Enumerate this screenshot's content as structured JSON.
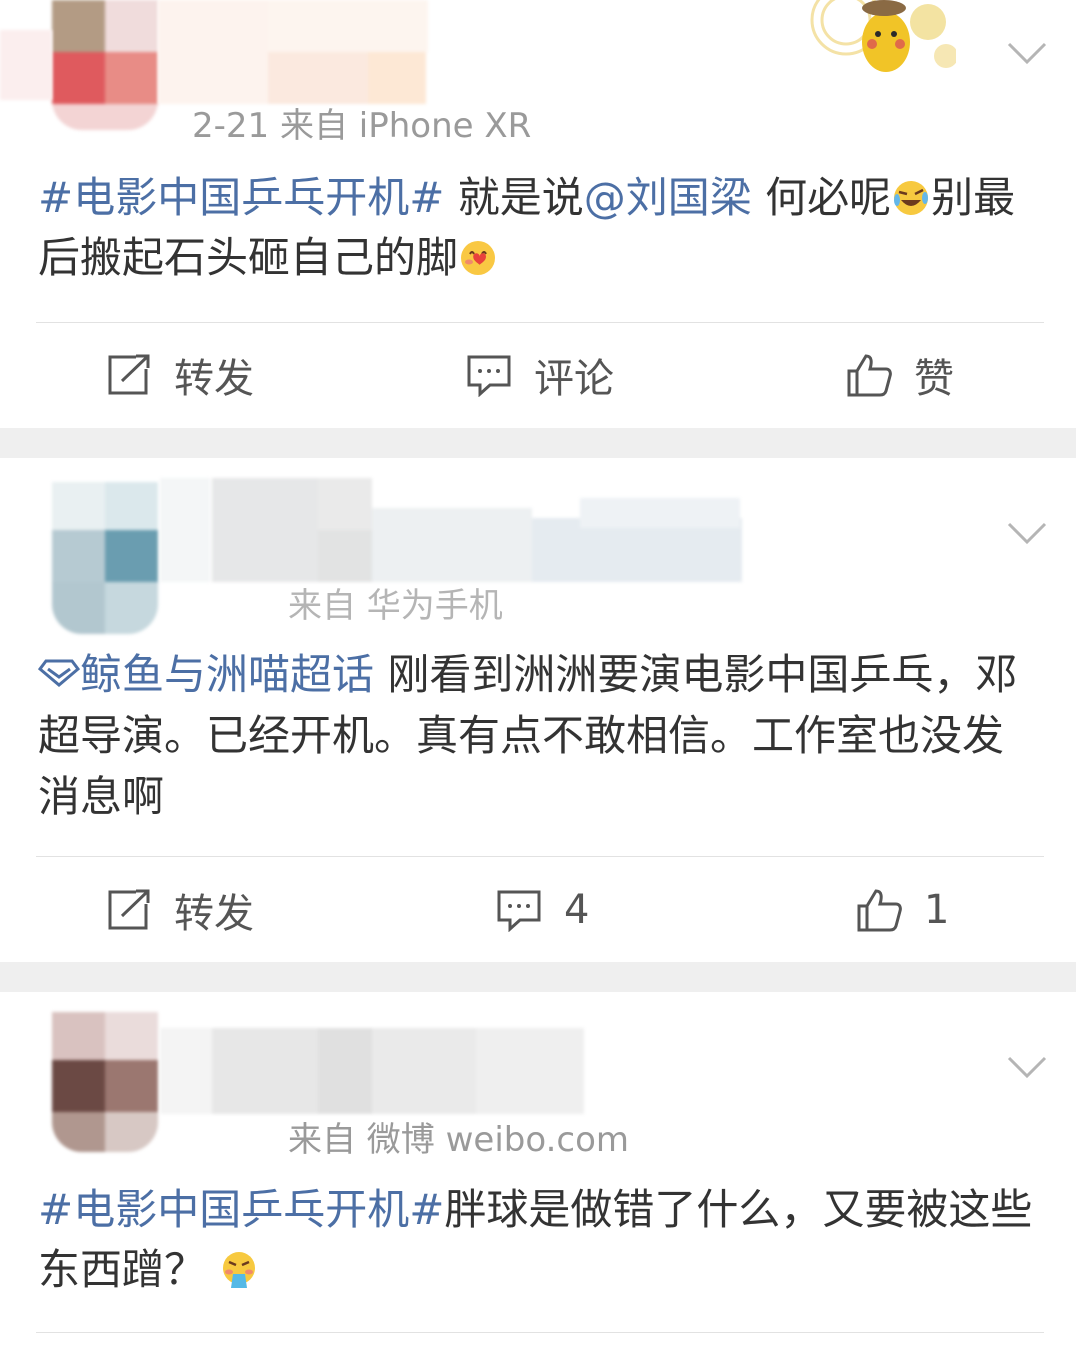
{
  "posts": [
    {
      "meta_text": "2-21  来自 iPhone XR",
      "body": [
        {
          "text": "#电影中国乒乓开机#",
          "link": true
        },
        {
          "text": " 就是说",
          "link": false
        },
        {
          "text": "@刘国梁",
          "link": true
        },
        {
          "text": " 何必呢",
          "link": false
        }
      ],
      "body_tail": "别最后搬起石头砸自己的脚",
      "emoji_1": "laugh-cry-emoji",
      "emoji_2": "heart-emoji",
      "repost_label": "转发",
      "comment_label": "评论",
      "like_label": "赞"
    },
    {
      "meta_text": "来自 华为手机",
      "supertopic": "鲸鱼与洲喵超话",
      "body_text": " 刚看到洲洲要演电影中国乒乓，邓超导演。已经开机。真有点不敢相信。工作室也没发消息啊",
      "repost_label": "转发",
      "comment_label": "4",
      "like_label": "1"
    },
    {
      "meta_text": "来自 微博 weibo.com",
      "hashtag": "#电影中国乒乓开机#",
      "body_text": "胖球是做错了什么，又要被这些东西蹭？",
      "emoji": "vomit-emoji"
    }
  ],
  "colors": {
    "link": "#4c6fa5",
    "meta": "#9a9a9a",
    "text": "#333333",
    "separator": "#efefef"
  }
}
